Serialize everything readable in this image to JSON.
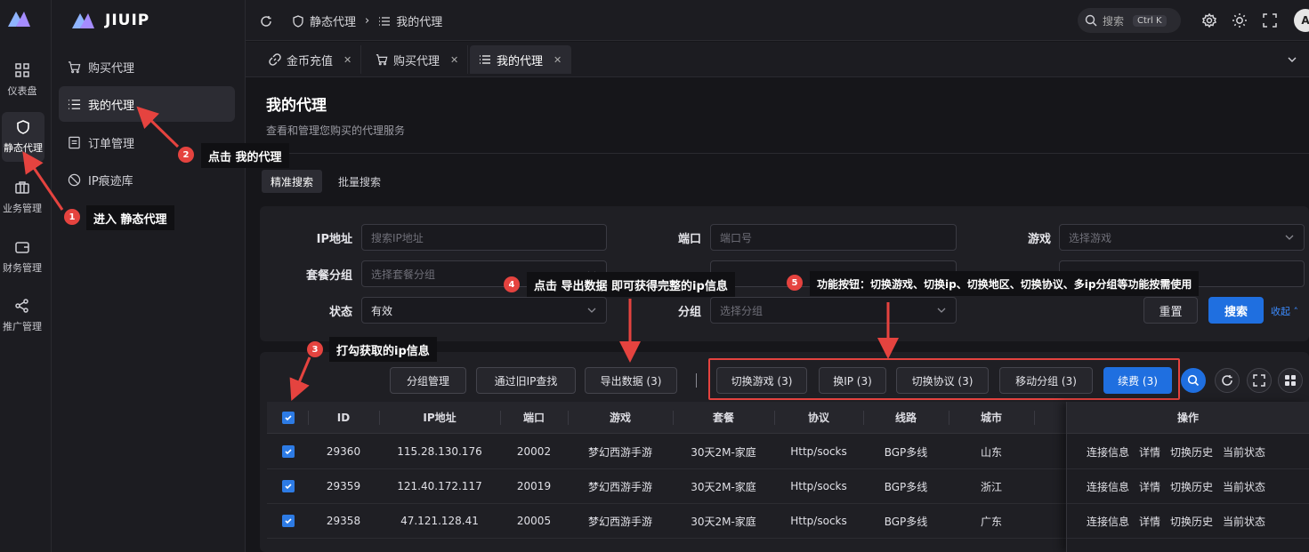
{
  "brand": {
    "name": "JIUIP"
  },
  "rail": [
    {
      "label": "仪表盘",
      "icon": "dashboard-icon"
    },
    {
      "label": "静态代理",
      "icon": "shield-icon",
      "active": true
    },
    {
      "label": "业务管理",
      "icon": "briefcase-icon"
    },
    {
      "label": "财务管理",
      "icon": "wallet-icon"
    },
    {
      "label": "推广管理",
      "icon": "share-icon"
    }
  ],
  "submenu": [
    {
      "label": "购买代理",
      "icon": "cart-icon"
    },
    {
      "label": "我的代理",
      "icon": "list-icon",
      "active": true
    },
    {
      "label": "订单管理",
      "icon": "order-icon"
    },
    {
      "label": "IP痕迹库",
      "icon": "ban-icon"
    }
  ],
  "topbar": {
    "crumb1": "静态代理",
    "crumb2": "我的代理",
    "search_label": "搜索",
    "shortcut": "Ctrl K",
    "avatar_letter": "A"
  },
  "tabs": [
    {
      "label": "金币充值",
      "icon": "link-icon"
    },
    {
      "label": "购买代理",
      "icon": "cart-icon"
    },
    {
      "label": "我的代理",
      "icon": "list-icon",
      "active": true
    }
  ],
  "page": {
    "title": "我的代理",
    "description": "查看和管理您购买的代理服务"
  },
  "search_tabs": [
    "精准搜索",
    "批量搜索"
  ],
  "filters": {
    "ip": {
      "label": "IP地址",
      "placeholder": "搜索IP地址"
    },
    "port": {
      "label": "端口",
      "placeholder": "端口号"
    },
    "game": {
      "label": "游戏",
      "placeholder": "选择游戏"
    },
    "package_group": {
      "label": "套餐分组",
      "placeholder": "选择套餐分组"
    },
    "status": {
      "label": "状态",
      "value": "有效"
    },
    "group": {
      "label": "分组",
      "placeholder": "选择分组"
    },
    "reset": "重置",
    "search": "搜索",
    "collapse": "收起"
  },
  "toolbar": {
    "group_manage": "分组管理",
    "old_ip_lookup": "通过旧IP查找",
    "export": "导出数据 (3)",
    "switch_game": "切换游戏 (3)",
    "switch_ip": "换IP (3)",
    "switch_protocol": "切换协议 (3)",
    "move_group": "移动分组 (3)",
    "renew": "续费 (3)"
  },
  "table": {
    "columns": [
      "ID",
      "IP地址",
      "端口",
      "游戏",
      "套餐",
      "协议",
      "线路",
      "城市",
      "操作"
    ],
    "rows": [
      {
        "id": "29360",
        "ip": "115.28.130.176",
        "port": "20002",
        "game": "梦幻西游手游",
        "package": "30天2M-家庭",
        "protocol": "Http/socks",
        "line": "BGP多线",
        "city": "山东"
      },
      {
        "id": "29359",
        "ip": "121.40.172.117",
        "port": "20019",
        "game": "梦幻西游手游",
        "package": "30天2M-家庭",
        "protocol": "Http/socks",
        "line": "BGP多线",
        "city": "浙江"
      },
      {
        "id": "29358",
        "ip": "47.121.128.41",
        "port": "20005",
        "game": "梦幻西游手游",
        "package": "30天2M-家庭",
        "protocol": "Http/socks",
        "line": "BGP多线",
        "city": "广东"
      }
    ],
    "actions": [
      "连接信息",
      "详情",
      "切换历史",
      "当前状态"
    ]
  },
  "annotations": [
    {
      "num": "1",
      "text": "进入 静态代理"
    },
    {
      "num": "2",
      "text": "点击 我的代理"
    },
    {
      "num": "3",
      "text": "打勾获取的ip信息"
    },
    {
      "num": "4",
      "text": "点击 导出数据 即可获得完整的ip信息"
    },
    {
      "num": "5",
      "text": "功能按钮：切换游戏、切换ip、切换地区、切换协议、多ip分组等功能按需使用"
    }
  ],
  "colors": {
    "accent": "#1f6fe0",
    "annotation": "#e5433f"
  }
}
